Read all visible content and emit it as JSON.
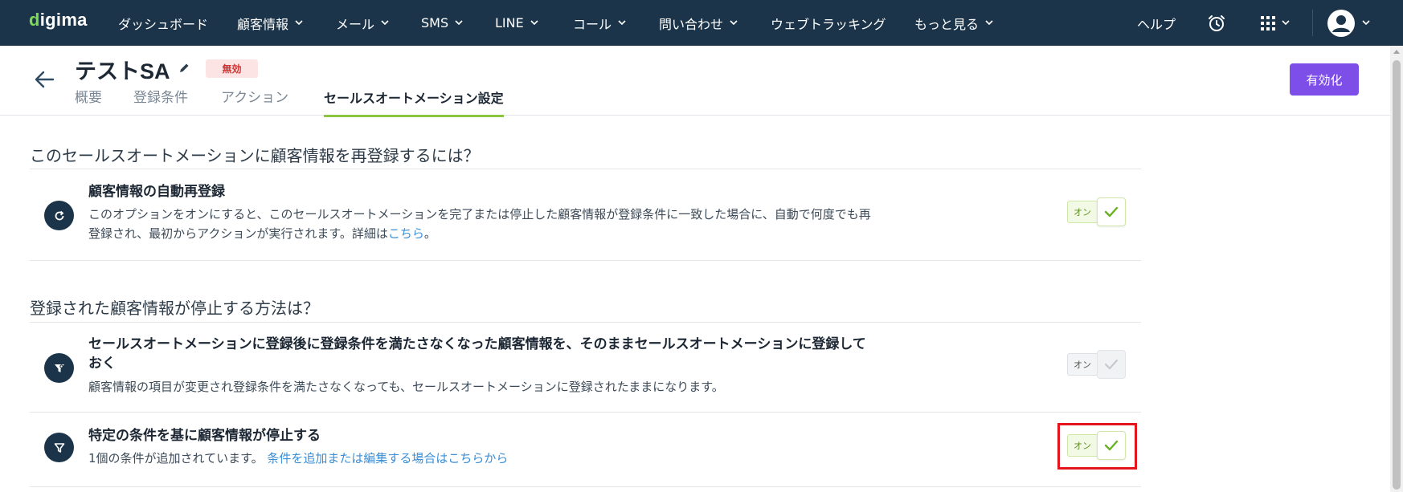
{
  "app": {
    "logo_prefix": "d",
    "logo_rest": "igima"
  },
  "nav": {
    "items": [
      {
        "label": "ダッシュボード",
        "has_menu": false
      },
      {
        "label": "顧客情報",
        "has_menu": true
      },
      {
        "label": "メール",
        "has_menu": true
      },
      {
        "label": "SMS",
        "has_menu": true
      },
      {
        "label": "LINE",
        "has_menu": true
      },
      {
        "label": "コール",
        "has_menu": true
      },
      {
        "label": "問い合わせ",
        "has_menu": true
      },
      {
        "label": "ウェブトラッキング",
        "has_menu": false
      },
      {
        "label": "もっと見る",
        "has_menu": true
      }
    ],
    "help_label": "ヘルプ",
    "icons": [
      "alarm-clock-icon",
      "apps-grid-icon",
      "user-avatar-icon"
    ]
  },
  "header": {
    "title": "テストSA",
    "status_badge": "無効",
    "enable_button": "有効化",
    "tabs": [
      {
        "label": "概要",
        "active": false
      },
      {
        "label": "登録条件",
        "active": false
      },
      {
        "label": "アクション",
        "active": false
      },
      {
        "label": "セールスオートメーション設定",
        "active": true
      }
    ]
  },
  "sections": [
    {
      "heading": "このセールスオートメーションに顧客情報を再登録するには？",
      "rows": [
        {
          "icon": "refresh-icon",
          "title": "顧客情報の自動再登録",
          "desc_line1": "このオプションをオンにすると、このセールスオートメーションを完了または停止した顧客情報が登録条件に一致した場合に、自動で何度でも再",
          "desc_line2": "登録され、最初からアクションが実行されます。詳細は",
          "link": "こちら",
          "desc_suffix": "。",
          "toggle_label": "オン",
          "toggle_on": true
        }
      ]
    },
    {
      "heading": "登録された顧客情報が停止する方法は？",
      "rows": [
        {
          "icon": "funnel-pin-icon",
          "title_line1": "セールスオートメーションに登録後に登録条件を満たさなくなった顧客情報を、そのままセールスオートメーションに登録して",
          "title_line2": "おく",
          "desc": "顧客情報の項目が変更され登録条件を満たさなくなっても、セールスオートメーションに登録されたままになります。",
          "toggle_label": "オン",
          "toggle_on": false
        },
        {
          "icon": "funnel-icon",
          "title": "特定の条件を基に顧客情報が停止する",
          "desc": "1個の条件が追加されています。",
          "link": "条件を追加または編集する場合はこちらから",
          "toggle_label": "オン",
          "toggle_on": true,
          "highlighted": true
        }
      ]
    }
  ],
  "colors": {
    "nav_bg": "#1c3449",
    "accent_green": "#8cc63f",
    "enable_button": "#7d4ee8",
    "badge_bg": "#fde4e4",
    "badge_text": "#d23232",
    "link": "#3a8fd8",
    "highlight": "#e3141b"
  }
}
